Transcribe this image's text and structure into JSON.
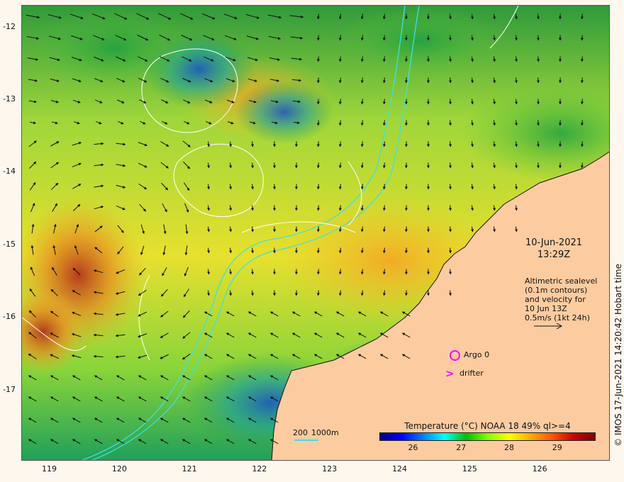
{
  "map": {
    "bounds": {
      "lon": [
        118.6,
        127.0
      ],
      "lat": [
        -17.98,
        -11.7
      ]
    },
    "lat_ticks": [
      {
        "value": -12,
        "label": "-12"
      },
      {
        "value": -13,
        "label": "-13"
      },
      {
        "value": -14,
        "label": "-14"
      },
      {
        "value": -15,
        "label": "-15"
      },
      {
        "value": -16,
        "label": "-16"
      },
      {
        "value": -17,
        "label": "-17"
      }
    ],
    "lon_ticks": [
      {
        "value": 119,
        "label": "119"
      },
      {
        "value": 120,
        "label": "120"
      },
      {
        "value": 121,
        "label": "121"
      },
      {
        "value": 122,
        "label": "122"
      },
      {
        "value": 123,
        "label": "123"
      },
      {
        "value": 124,
        "label": "124"
      },
      {
        "value": 125,
        "label": "125"
      },
      {
        "value": 126,
        "label": "126"
      }
    ],
    "land_color": "#fccca0",
    "contour_color": "#ffffff",
    "isobath_color": "#3fe0e0"
  },
  "datetime": {
    "date": "10-Jun-2021",
    "time": "13:29Z"
  },
  "legend": {
    "lines": [
      "Altimetric sealevel",
      "(0.1m contours)",
      "and velocity for",
      "10 Jun 13Z",
      "0.5m/s (1kt 24h)"
    ]
  },
  "markers": {
    "argo_label": "Argo 0",
    "drifter_label": "drifter",
    "drifter_symbol": ">",
    "color": "#ff00ff"
  },
  "contour_scale": {
    "label_200": "200",
    "label_1000": "1000m"
  },
  "colorbar": {
    "title": "Temperature (°C) NOAA 18 49% ql>=4",
    "range": [
      25.3,
      29.8
    ],
    "ticks": [
      {
        "value": 26,
        "label": "26"
      },
      {
        "value": 27,
        "label": "27"
      },
      {
        "value": 28,
        "label": "28"
      },
      {
        "value": 29,
        "label": "29"
      }
    ],
    "colors": [
      "#00007f",
      "#0000ff",
      "#007fff",
      "#00ffff",
      "#00c000",
      "#7fff00",
      "#ffff00",
      "#ffaa00",
      "#ff5500",
      "#cc0000",
      "#7f0000"
    ]
  },
  "credit": "© IMOS 17-Jun-2021 14:20:42 Hobart time"
}
